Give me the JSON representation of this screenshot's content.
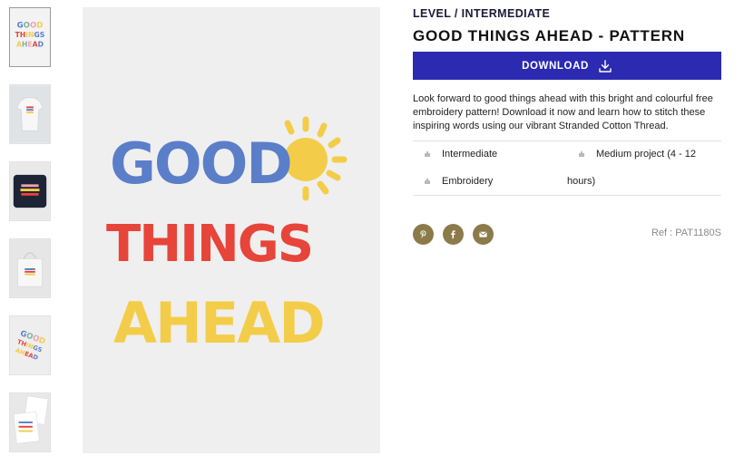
{
  "gallery": {
    "thumbnails": [
      {
        "name": "pattern-artwork",
        "active": true
      },
      {
        "name": "t-shirt"
      },
      {
        "name": "cushion"
      },
      {
        "name": "tote-bag"
      },
      {
        "name": "artwork-tilted"
      },
      {
        "name": "printed-sheets"
      }
    ],
    "artwork_lines": [
      "GOOD",
      "THINGS",
      "AHEAD"
    ]
  },
  "product": {
    "level": "LEVEL / INTERMEDIATE",
    "title": "GOOD THINGS AHEAD - PATTERN",
    "download_label": "DOWNLOAD",
    "description": "Look forward to good things ahead with this bright and colourful free embroidery pattern! Download it now and learn how to stitch these inspiring words using our vibrant Stranded Cotton Thread.",
    "attributes": {
      "level": "Intermediate",
      "size_line1": "Medium project (4 - 12",
      "size_line2": "hours)",
      "technique": "Embroidery"
    },
    "share": [
      "pinterest-icon",
      "facebook-icon",
      "email-icon"
    ],
    "ref": "Ref : PAT1180S"
  },
  "colors": {
    "button": "#2b2ab0",
    "share": "#8c7a4b",
    "blue": "#5b7ec9",
    "green": "#7fb0a0",
    "pink": "#f0a0b4",
    "yellow": "#f3cd4a",
    "red": "#e7443a"
  }
}
